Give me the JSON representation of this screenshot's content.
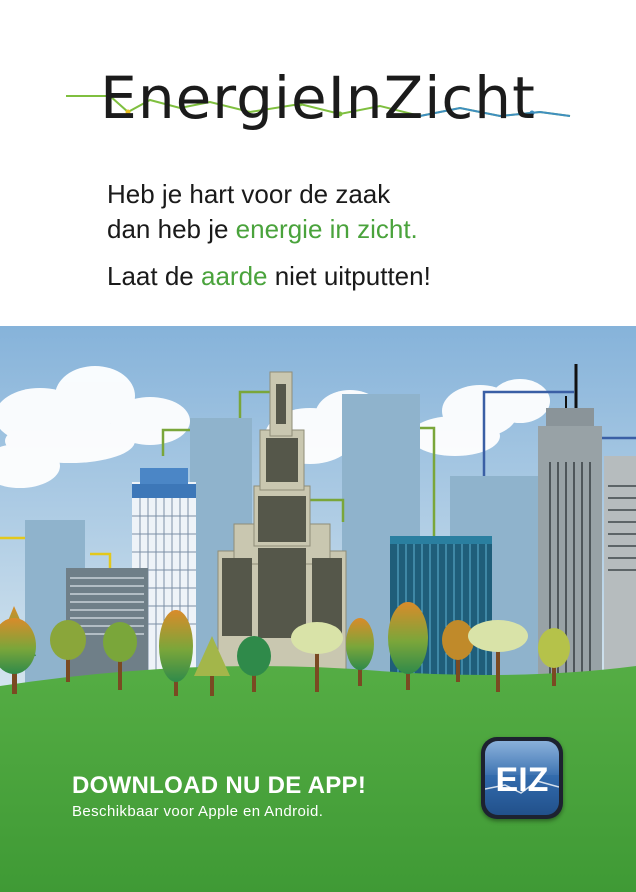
{
  "logo": {
    "text": "EnergieInZicht"
  },
  "tagline": {
    "line1": "Heb je hart voor de zaak",
    "line2_prefix": "dan heb je ",
    "line2_highlight": "energie in zicht.",
    "line3_prefix": "Laat de ",
    "line3_highlight": "aarde",
    "line3_suffix": " niet uitputten!"
  },
  "cta": {
    "title": "DOWNLOAD NU DE APP!",
    "subtitle": "Beschikbaar voor Apple en Android."
  },
  "app_icon": {
    "label": "EIZ"
  },
  "colors": {
    "green": "#4aa33c",
    "grass": "#45a33b",
    "sky_top": "#8fb6d9",
    "app_blue": "#2f67a8"
  }
}
